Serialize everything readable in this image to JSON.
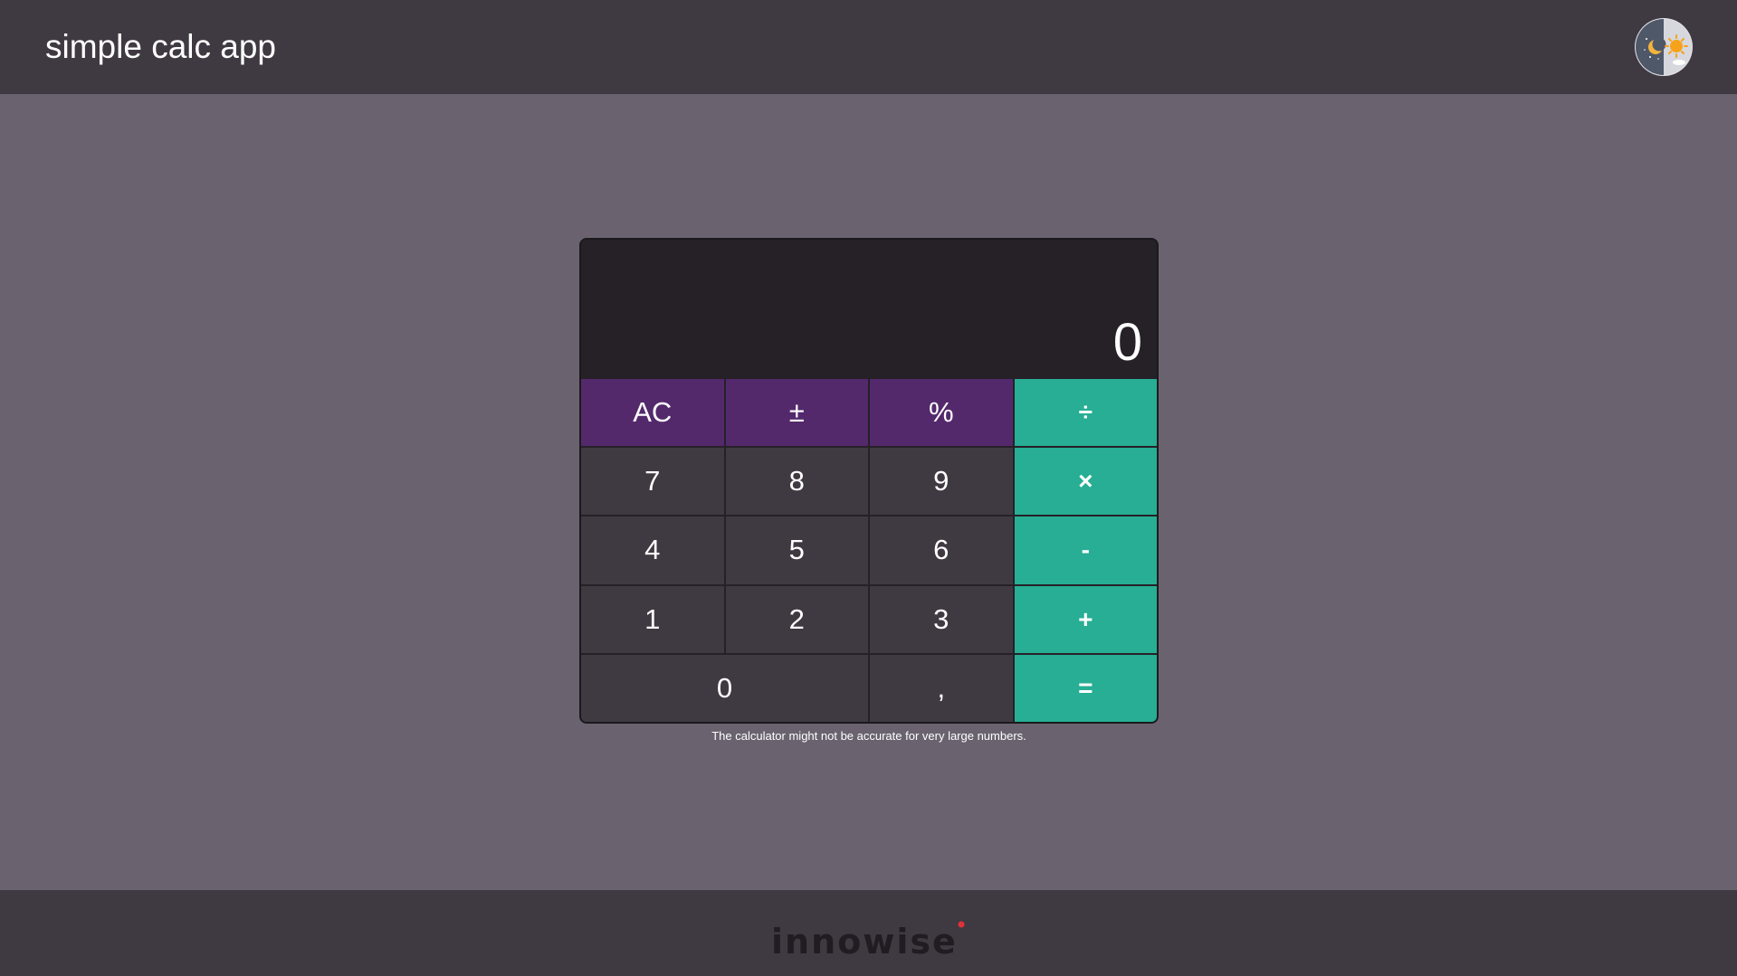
{
  "header": {
    "title": "simple calc app",
    "theme_toggle_icon": "day-night-toggle-icon"
  },
  "calculator": {
    "display_value": "0",
    "keys": [
      {
        "label": "AC",
        "kind": "fn"
      },
      {
        "label": "±",
        "kind": "fn"
      },
      {
        "label": "%",
        "kind": "fn"
      },
      {
        "label": "÷",
        "kind": "op"
      },
      {
        "label": "7",
        "kind": "num"
      },
      {
        "label": "8",
        "kind": "num"
      },
      {
        "label": "9",
        "kind": "num"
      },
      {
        "label": "×",
        "kind": "op"
      },
      {
        "label": "4",
        "kind": "num"
      },
      {
        "label": "5",
        "kind": "num"
      },
      {
        "label": "6",
        "kind": "num"
      },
      {
        "label": "-",
        "kind": "op"
      },
      {
        "label": "1",
        "kind": "num"
      },
      {
        "label": "2",
        "kind": "num"
      },
      {
        "label": "3",
        "kind": "num"
      },
      {
        "label": "+",
        "kind": "op"
      },
      {
        "label": "0",
        "kind": "num"
      },
      {
        "label": ",",
        "kind": "num"
      },
      {
        "label": "=",
        "kind": "op"
      }
    ],
    "disclaimer": "The calculator might not be accurate for very large numbers."
  },
  "footer": {
    "logo_text": "innowise"
  },
  "colors": {
    "header_bg": "#3f3a42",
    "page_bg": "#6a636f",
    "function_key": "#54296c",
    "number_key": "#3f3a42",
    "operator_key": "#27ae94",
    "display_bg": "#252127",
    "logo_dot": "#e0303a"
  }
}
